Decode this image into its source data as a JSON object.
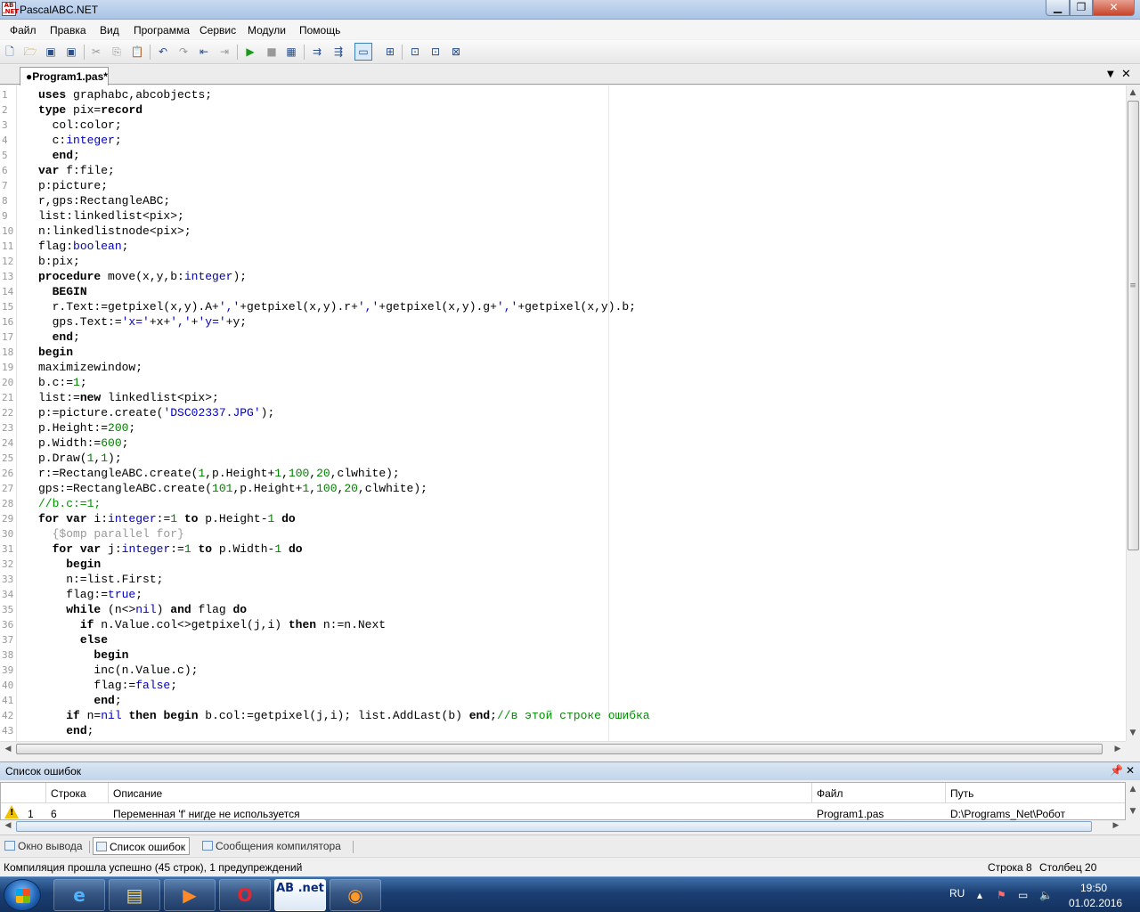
{
  "window": {
    "title": "PascalABC.NET",
    "icon_text": "AB"
  },
  "menu": [
    "Файл",
    "Правка",
    "Вид",
    "Программа",
    "Сервис",
    "Модули",
    "Помощь"
  ],
  "editor": {
    "tab_label": "●Program1.pas*",
    "lines": [
      "uses graphabc,abcobjects;",
      "type pix=record",
      "  col:color;",
      "  c:integer;",
      "  end;",
      "var f:file;",
      "p:picture;",
      "r,gps:RectangleABC;",
      "list:linkedlist<pix>;",
      "n:linkedlistnode<pix>;",
      "flag:boolean;",
      "b:pix;",
      "procedure move(x,y,b:integer);",
      "  BEGIN",
      "  r.Text:=getpixel(x,y).A+','+getpixel(x,y).r+','+getpixel(x,y).g+','+getpixel(x,y).b;",
      "  gps.Text:='x='+x+','+'y='+y;",
      "  end;",
      "begin",
      "maximizewindow;",
      "b.c:=1;",
      "list:=new linkedlist<pix>;",
      "p:=picture.create('DSC02337.JPG');",
      "p.Height:=200;",
      "p.Width:=600;",
      "p.Draw(1,1);",
      "r:=RectangleABC.create(1,p.Height+1,100,20,clwhite);",
      "gps:=RectangleABC.create(101,p.Height+1,100,20,clwhite);",
      "//b.c:=1;",
      "for var i:integer:=1 to p.Height-1 do",
      "  {$omp parallel for}",
      "  for var j:integer:=1 to p.Width-1 do",
      "    begin",
      "    n:=list.First;",
      "    flag:=true;",
      "    while (n<>nil) and flag do",
      "      if n.Value.col<>getpixel(j,i) then n:=n.Next",
      "      else",
      "        begin",
      "        inc(n.Value.c);",
      "        flag:=false;",
      "        end;",
      "    if n=nil then begin b.col:=getpixel(j,i); list.AddLast(b) end;//в этой строке ошибка",
      "    end;"
    ]
  },
  "error_panel": {
    "title": "Список ошибок",
    "columns": [
      "Строка",
      "Описание",
      "Файл",
      "Путь"
    ],
    "rows": [
      {
        "index": "1",
        "line": "6",
        "description": "Переменная 'f' нигде не используется",
        "file": "Program1.pas",
        "path": "D:\\Programs_Net\\Робот"
      }
    ]
  },
  "bottom_tabs": [
    "Окно вывода",
    "Список ошибок",
    "Сообщения компилятора"
  ],
  "status": {
    "message": "Компиляция прошла успешно (45 строк), 1 предупреждений",
    "row": "Строка  8",
    "col": "Столбец  20"
  },
  "taskbar": {
    "lang": "RU",
    "time": "19:50",
    "date": "01.02.2016",
    "active_app_label": "AB .net"
  },
  "colors": {
    "keyword": "#000000",
    "type": "#0000c0",
    "number": "#008000",
    "comment": "#009000",
    "directive": "#999999"
  }
}
